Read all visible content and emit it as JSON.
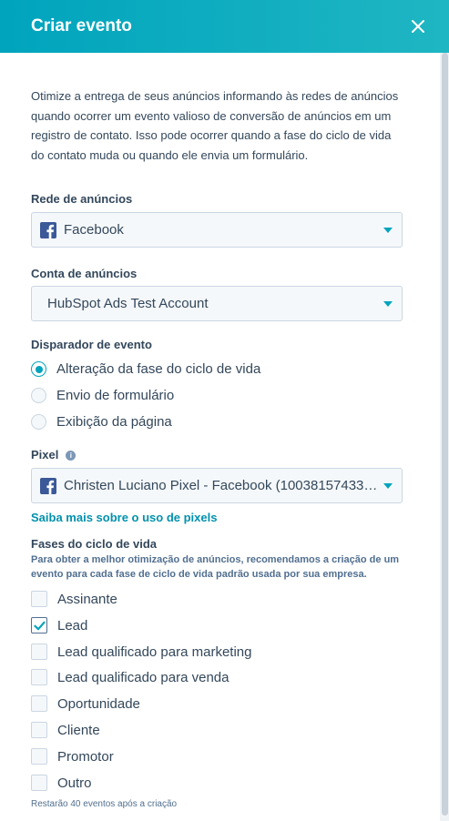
{
  "header": {
    "title": "Criar evento",
    "close_icon": "close-icon"
  },
  "intro": "Otimize a entrega de seus anúncios informando às redes de anúncios quando ocorrer um evento valioso de conversão de anúncios em um registro de contato. Isso pode ocorrer quando a fase do ciclo de vida do contato muda ou quando ele envia um formulário.",
  "ad_network": {
    "label": "Rede de anúncios",
    "value": "Facebook",
    "icon": "facebook-icon"
  },
  "ad_account": {
    "label": "Conta de anúncios",
    "value": "HubSpot Ads Test Account"
  },
  "trigger": {
    "label": "Disparador de evento",
    "options": [
      {
        "label": "Alteração da fase do ciclo de vida",
        "selected": true
      },
      {
        "label": "Envio de formulário",
        "selected": false
      },
      {
        "label": "Exibição da página",
        "selected": false
      }
    ]
  },
  "pixel": {
    "label": "Pixel",
    "value": "Christen Luciano Pixel - Facebook (100381574334...",
    "info_icon": "info-icon"
  },
  "pixel_link": "Saiba mais sobre o uso de pixels",
  "lifecycle": {
    "label": "Fases do ciclo de vida",
    "help": "Para obter a melhor otimização de anúncios, recomendamos a criação de um evento para cada fase de ciclo de vida padrão usada por sua empresa.",
    "options": [
      {
        "label": "Assinante",
        "checked": false
      },
      {
        "label": "Lead",
        "checked": true
      },
      {
        "label": "Lead qualificado para marketing",
        "checked": false
      },
      {
        "label": "Lead qualificado para venda",
        "checked": false
      },
      {
        "label": "Oportunidade",
        "checked": false
      },
      {
        "label": "Cliente",
        "checked": false
      },
      {
        "label": "Promotor",
        "checked": false
      },
      {
        "label": "Outro",
        "checked": false
      }
    ]
  },
  "footer_note": "Restarão 40 eventos após a criação",
  "colors": {
    "accent": "#00a4bd",
    "link": "#0091ae",
    "text": "#33475b",
    "facebook": "#3b5998"
  }
}
